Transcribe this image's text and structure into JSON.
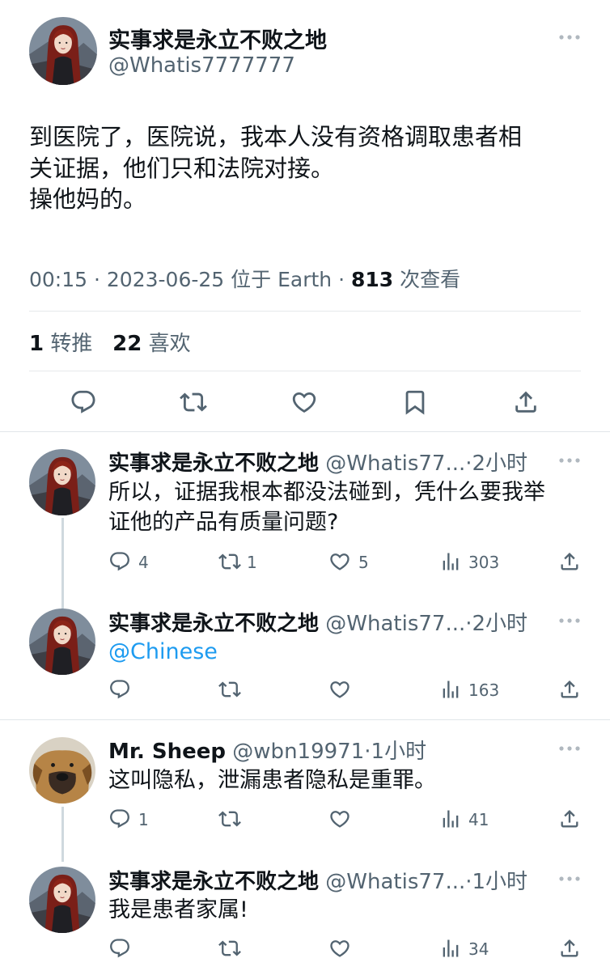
{
  "main_tweet": {
    "display_name": "实事求是永立不败之地",
    "handle": "@Whatis7777777",
    "text": "到医院了，医院说，我本人没有资格调取患者相\n关证据，他们只和法院对接。\n操他妈的。",
    "time": "00:15",
    "date": "2023-06-25",
    "location": "位于 Earth",
    "views": "813",
    "views_label": "次查看",
    "retweets": "1",
    "retweets_label": "转推",
    "likes": "22",
    "likes_label": "喜欢"
  },
  "replies": [
    {
      "display_name": "实事求是永立不败之地",
      "handle": "@Whatis77...",
      "time": "2小时",
      "text": "所以，证据我根本都没法碰到，凭什么要我举\n证他的产品有质量问题?",
      "replies": "4",
      "retweets": "1",
      "likes": "5",
      "views": "303"
    },
    {
      "display_name": "实事求是永立不败之地",
      "handle": "@Whatis77...",
      "time": "2小时",
      "text": "@Chinese",
      "replies": "",
      "retweets": "",
      "likes": "",
      "views": "163"
    },
    {
      "display_name": "Mr. Sheep",
      "handle": "@wbn19971",
      "time": "1小时",
      "text": "这叫隐私，泄漏患者隐私是重罪。",
      "replies": "1",
      "retweets": "",
      "likes": "",
      "views": "41"
    },
    {
      "display_name": "实事求是永立不败之地",
      "handle": "@Whatis77...",
      "time": "1小时",
      "text": "我是患者家属!",
      "replies": "",
      "retweets": "",
      "likes": "",
      "views": "34"
    }
  ],
  "icons": {
    "reply": "reply-icon",
    "retweet": "retweet-icon",
    "like": "heart-icon",
    "bookmark": "bookmark-icon",
    "share": "share-icon",
    "views": "views-icon",
    "more": "more-icon"
  },
  "colors": {
    "text": "#0f1419",
    "secondary": "#536471",
    "link": "#1d9bf0",
    "divider": "#e6e9eb"
  }
}
